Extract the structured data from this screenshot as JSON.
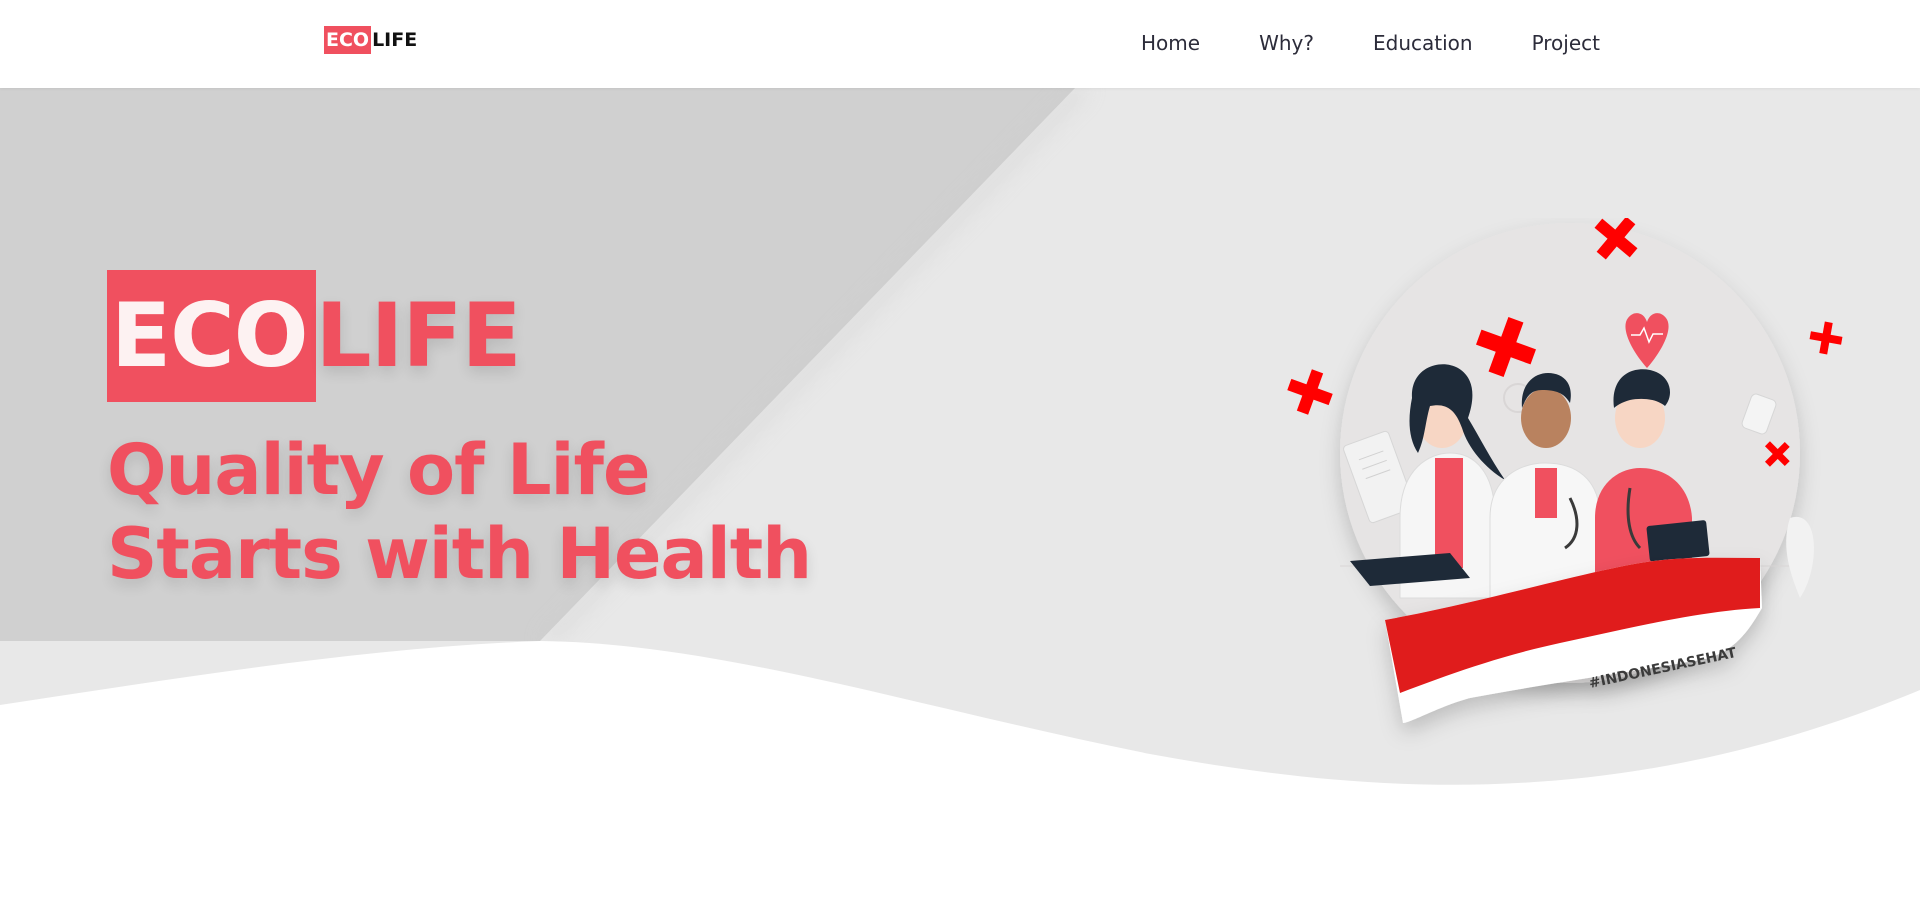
{
  "navbar": {
    "logo": {
      "eco": "ECO",
      "life": "LIFE"
    },
    "links": [
      "Home",
      "Why?",
      "Education",
      "Project"
    ]
  },
  "hero": {
    "brand": {
      "eco": "ECO",
      "life": "LIFE"
    },
    "tagline": "Quality of Life Starts with Health",
    "illustration": {
      "hashtag": "#INDONESIASEHAT",
      "icons": [
        "red-cross-icon",
        "heart-icon",
        "doctor-figure"
      ]
    }
  },
  "colors": {
    "accent": "#f0505f",
    "bg_dark": "#d0d0d0",
    "bg_light": "#e8e8e8",
    "cross": "#ff0000",
    "flag_red": "#e01b1b"
  }
}
